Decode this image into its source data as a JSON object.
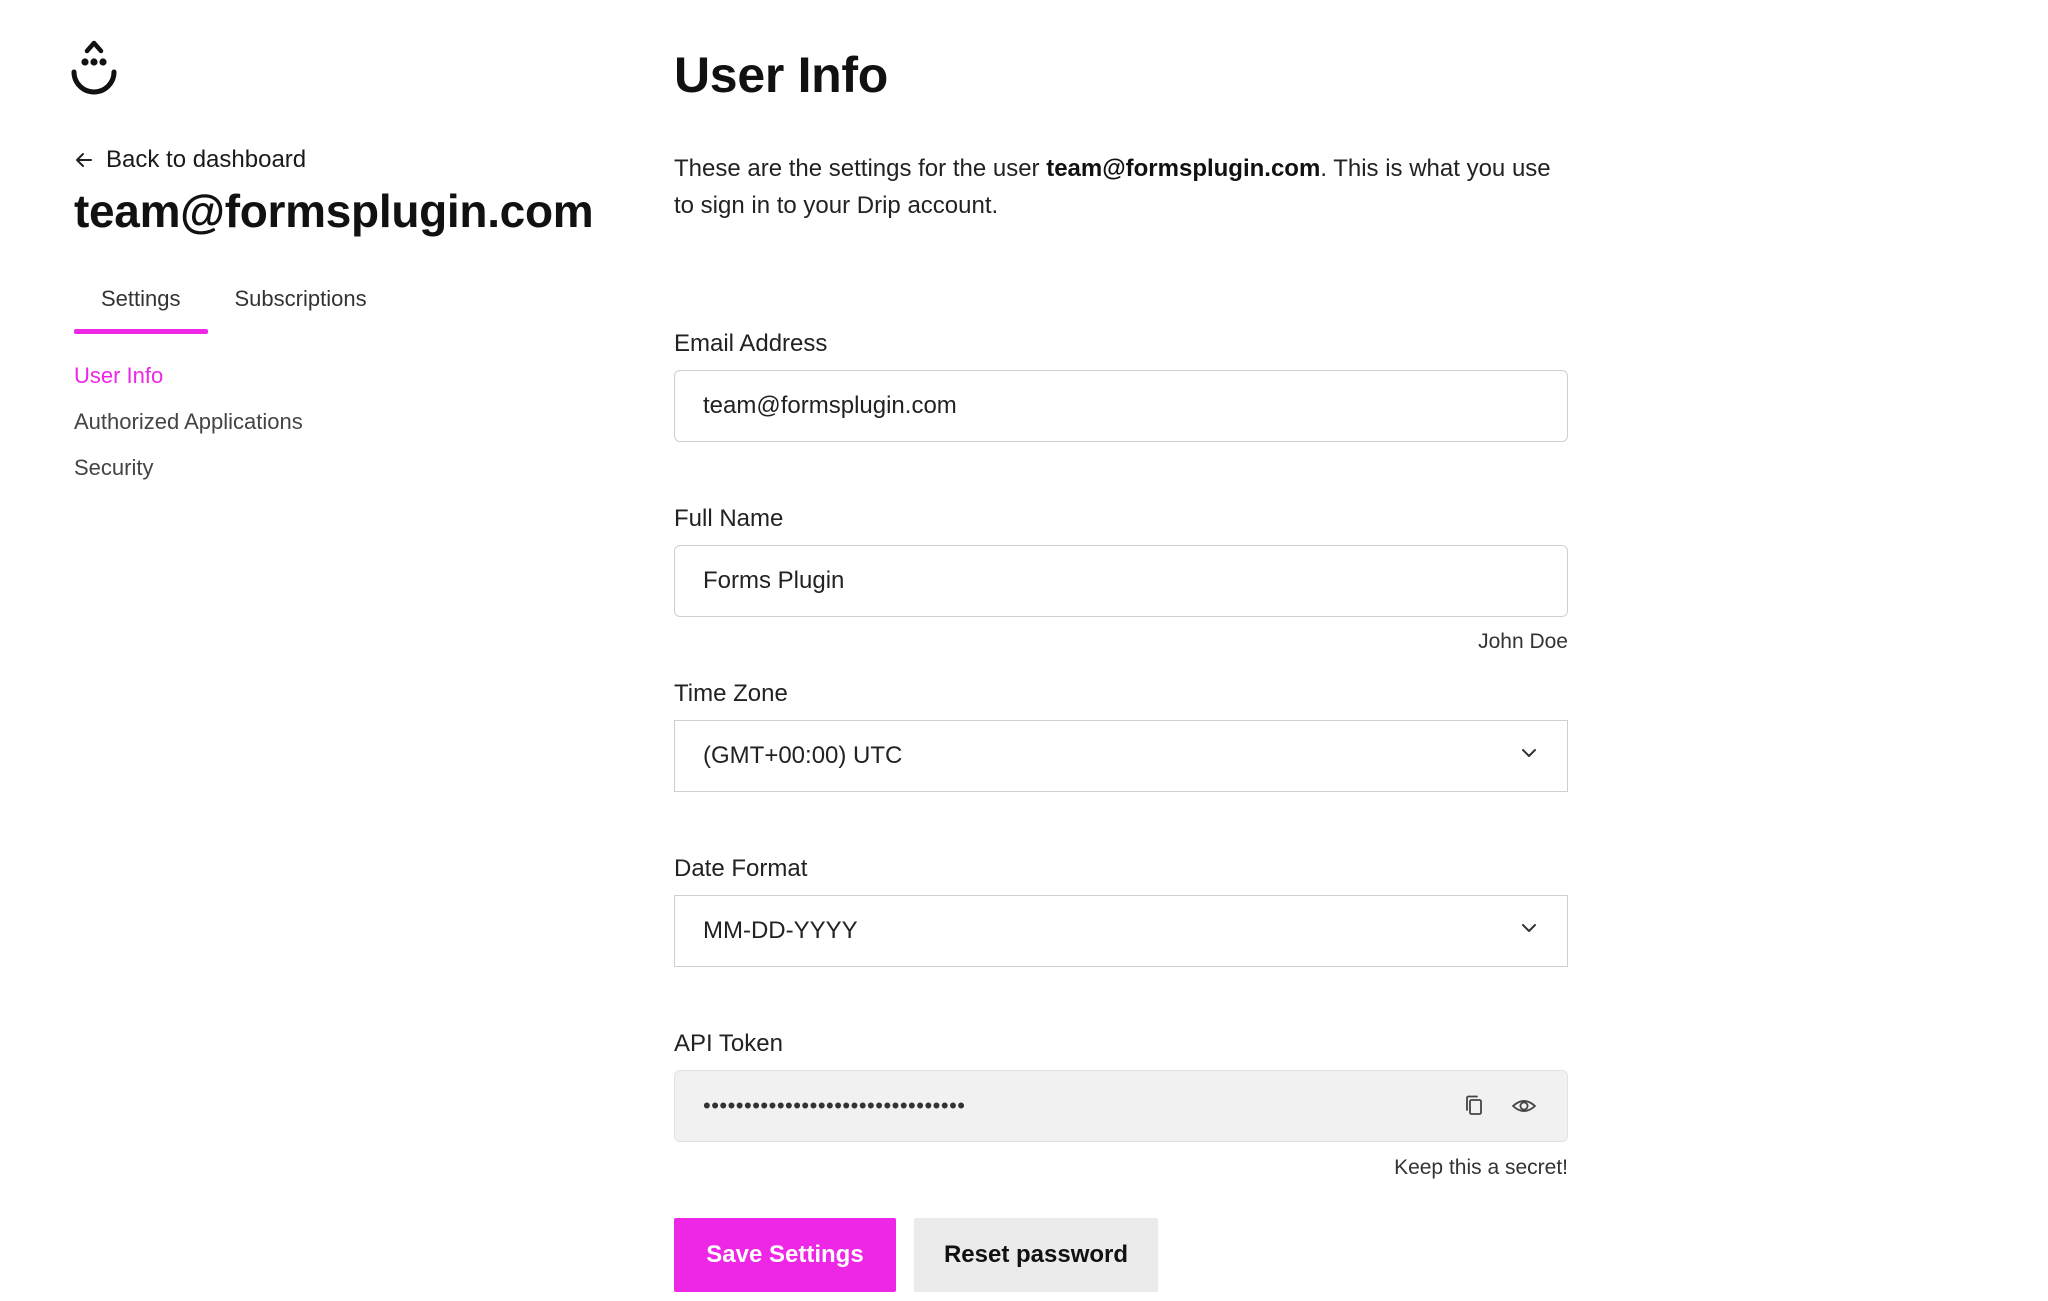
{
  "sidebar": {
    "logo_icon": "drip-smile-logo-icon",
    "back_link": "Back to dashboard",
    "account_email": "team@formsplugin.com",
    "tabs": [
      {
        "label": "Settings",
        "active": true
      },
      {
        "label": "Subscriptions",
        "active": false
      }
    ],
    "subnav": [
      {
        "label": "User Info",
        "active": true
      },
      {
        "label": "Authorized Applications",
        "active": false
      },
      {
        "label": "Security",
        "active": false
      }
    ]
  },
  "main": {
    "title": "User Info",
    "intro_prefix": "These are the settings for the user ",
    "intro_email": "team@formsplugin.com",
    "intro_suffix": ". This is what you use to sign in to your Drip account.",
    "fields": {
      "email": {
        "label": "Email Address",
        "value": "team@formsplugin.com"
      },
      "full_name": {
        "label": "Full Name",
        "value": "Forms Plugin",
        "hint": "John Doe"
      },
      "time_zone": {
        "label": "Time Zone",
        "value": "(GMT+00:00) UTC"
      },
      "date_format": {
        "label": "Date Format",
        "value": "MM-DD-YYYY"
      },
      "api_token": {
        "label": "API Token",
        "masked_value": "••••••••••••••••••••••••••••••••",
        "hint": "Keep this a secret!"
      }
    },
    "buttons": {
      "save": "Save Settings",
      "reset": "Reset password"
    }
  },
  "colors": {
    "accent": "#ee26e6",
    "text": "#1a1a1a",
    "input_border": "#cfcfcf",
    "token_background": "#f1f1f1",
    "secondary_button": "#ebebeb"
  }
}
